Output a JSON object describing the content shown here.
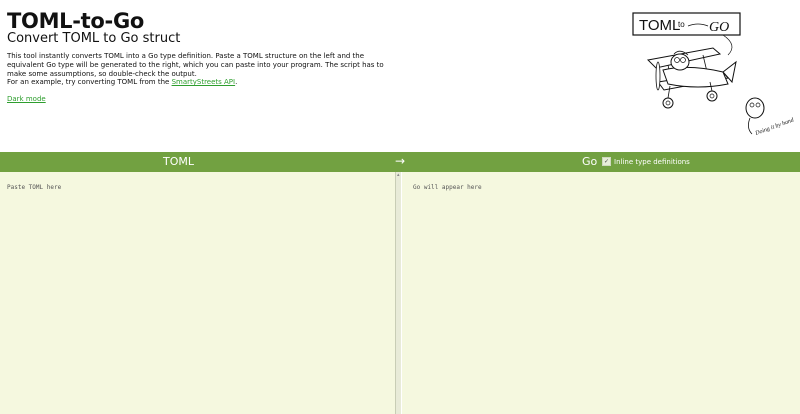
{
  "header": {
    "title": "TOML-to-Go",
    "subtitle": "Convert TOML to Go struct",
    "description": "This tool instantly converts TOML into a Go type definition. Paste a TOML structure on the left and the equivalent Go type will be generated to the right, which you can paste into your program. The script has to make some assumptions, so double-check the output.",
    "example_prefix": "For an example, try converting TOML from the ",
    "example_link": "SmartyStreets API",
    "example_suffix": ".",
    "dark_mode": "Dark mode"
  },
  "illustration": {
    "sign_left": "TOML",
    "sign_mid": "to",
    "sign_right": "GO",
    "caption": "Doing it by hand"
  },
  "toolbar": {
    "left_label": "TOML",
    "arrow": "→",
    "right_label": "Go",
    "inline_label": "Inline type definitions",
    "inline_checked": true,
    "check_glyph": "✓"
  },
  "editors": {
    "toml_placeholder": "Paste TOML here",
    "go_placeholder": "Go will appear here"
  },
  "colors": {
    "bar": "#72a141",
    "editor_bg": "#f5f8df",
    "link": "#2e9e2e"
  }
}
